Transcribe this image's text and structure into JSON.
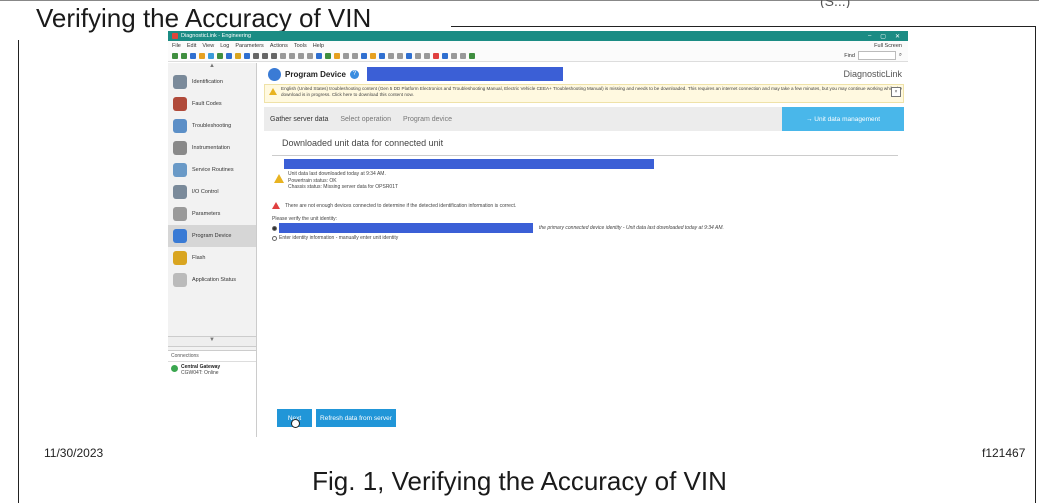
{
  "document": {
    "title": "Verifying the Accuracy of VIN",
    "top_cut_text": "(S...)",
    "date": "11/30/2023",
    "figure_id": "f121467",
    "caption": "Fig. 1, Verifying the Accuracy of VIN"
  },
  "app": {
    "window_title": "DiagnosticLink - Engineering",
    "window_controls": [
      "–",
      "▢",
      "✕"
    ],
    "menu": [
      "File",
      "Edit",
      "View",
      "Log",
      "Parameters",
      "Actions",
      "Tools",
      "Help"
    ],
    "full_screen_label": "Full Screen",
    "find_label": "Find",
    "toolbar_colors": [
      "#3f8e3f",
      "#3f8e3f",
      "#2f6fd0",
      "#e6a020",
      "#3a9ad9",
      "#3f8e3f",
      "#2f6fd0",
      "#d9a520",
      "#2f6fd0",
      "#666666",
      "#666666",
      "#666666",
      "#999999",
      "#999999",
      "#999999",
      "#999999",
      "#2f6fd0",
      "#3f8e3f",
      "#e6a020",
      "#999999",
      "#999999",
      "#2f6fd0",
      "#e6a020",
      "#2f6fd0",
      "#999999",
      "#999999",
      "#2f6fd0",
      "#999999",
      "#999999",
      "#e04040",
      "#2f6fd0",
      "#999999",
      "#999999",
      "#3f8e3f"
    ]
  },
  "sidebar": {
    "items": [
      {
        "label": "Identification",
        "icon": "id-card-icon",
        "color": "#7a8a9a",
        "active": false
      },
      {
        "label": "Fault Codes",
        "icon": "fault-codes-icon",
        "color": "#b04a3a",
        "active": false
      },
      {
        "label": "Troubleshooting",
        "icon": "troubleshooting-icon",
        "color": "#5c8fc7",
        "active": false
      },
      {
        "label": "Instrumentation",
        "icon": "gauge-icon",
        "color": "#8a8a8a",
        "active": false
      },
      {
        "label": "Service Routines",
        "icon": "gear-icon",
        "color": "#6a9ac7",
        "active": false
      },
      {
        "label": "I/O Control",
        "icon": "io-control-icon",
        "color": "#7a8a9a",
        "active": false
      },
      {
        "label": "Parameters",
        "icon": "parameters-icon",
        "color": "#9a9a9a",
        "active": false
      },
      {
        "label": "Program Device",
        "icon": "program-device-icon",
        "color": "#3a7bd5",
        "active": true
      },
      {
        "label": "Flash",
        "icon": "flash-icon",
        "color": "#d9a520",
        "active": false
      },
      {
        "label": "Application Status",
        "icon": "application-status-icon",
        "color": "#bbbbbb",
        "active": false
      }
    ],
    "connections_header": "Connections",
    "connection_name": "Central Gateway",
    "connection_status": "CGW04T: Online"
  },
  "main": {
    "header_title": "Program Device",
    "brand": "DiagnosticLink",
    "warning_text": "English (United States) troubleshooting content (Gen 5 DD Platform Electronics and Troubleshooting Manual, Electric Vehicle CEEA+ Troubleshooting Manual) is missing and needs to be downloaded. This requires an internet connection and may take a few minutes, but you may continue working while the download is in progress. Click here to download this content now.",
    "tabs": [
      "Gather server data",
      "Select operation",
      "Program device"
    ],
    "unit_data_button": "→ Unit data management",
    "panel_title": "Downloaded unit data for connected unit",
    "unit_info": [
      "Unit data last downloaded today at 9:34 AM.",
      "Powertrain status: OK",
      "Chassis status: Missing server data for OPSR01T"
    ],
    "error_text": "There are not enough devices connected to determine if the detected identification information is correct.",
    "verify_prompt": "Please verify the unit identity:",
    "option1_text": "the primary connected device identity - Unit data last downloaded today at 9:34 AM.",
    "option2_text": "Enter identity information - manually enter unit identity",
    "next_button": "Next",
    "refresh_button": "Refresh data from server"
  }
}
